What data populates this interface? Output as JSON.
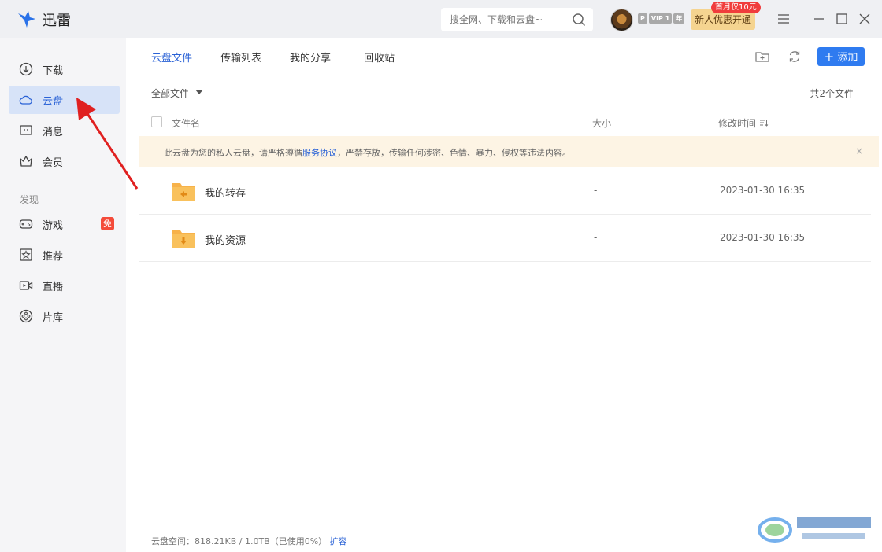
{
  "app": {
    "title": "迅雷"
  },
  "search": {
    "placeholder": "搜全网、下载和云盘~"
  },
  "user": {
    "vip_p": "P",
    "vip_level": "VIP 1",
    "vip_year": "年",
    "promo_button": "新人优惠开通",
    "promo_tag": "首月仅10元"
  },
  "sidebar": {
    "items": [
      {
        "label": "下载",
        "icon": "download-icon"
      },
      {
        "label": "云盘",
        "icon": "cloud-icon"
      },
      {
        "label": "消息",
        "icon": "message-icon"
      },
      {
        "label": "会员",
        "icon": "crown-icon"
      }
    ],
    "section_title": "发现",
    "discover": [
      {
        "label": "游戏",
        "icon": "gamepad-icon",
        "badge": "免"
      },
      {
        "label": "推荐",
        "icon": "star-icon"
      },
      {
        "label": "直播",
        "icon": "live-icon"
      },
      {
        "label": "片库",
        "icon": "film-reel-icon"
      }
    ]
  },
  "tabs": [
    {
      "label": "云盘文件"
    },
    {
      "label": "传输列表"
    },
    {
      "label": "我的分享"
    },
    {
      "label": "回收站"
    }
  ],
  "toolbar": {
    "add_label": "添加"
  },
  "filter": {
    "label": "全部文件",
    "count": "共2个文件"
  },
  "columns": {
    "name": "文件名",
    "size": "大小",
    "modified": "修改时间"
  },
  "notice": {
    "before": "此云盘为您的私人云盘，请严格遵循",
    "link": "服务协议",
    "after": "，严禁存放，传输任何涉密、色情、暴力、侵权等违法内容。",
    "close": "×"
  },
  "files": [
    {
      "name": "我的转存",
      "size": "-",
      "modified": "2023-01-30 16:35"
    },
    {
      "name": "我的资源",
      "size": "-",
      "modified": "2023-01-30 16:35"
    }
  ],
  "footer": {
    "storage": "云盘空间：818.21KB / 1.0TB（已使用0%）",
    "expand": "扩容"
  },
  "colors": {
    "accent": "#2a62d6",
    "folder": "#f7b24a",
    "arrow": "#e02020"
  }
}
